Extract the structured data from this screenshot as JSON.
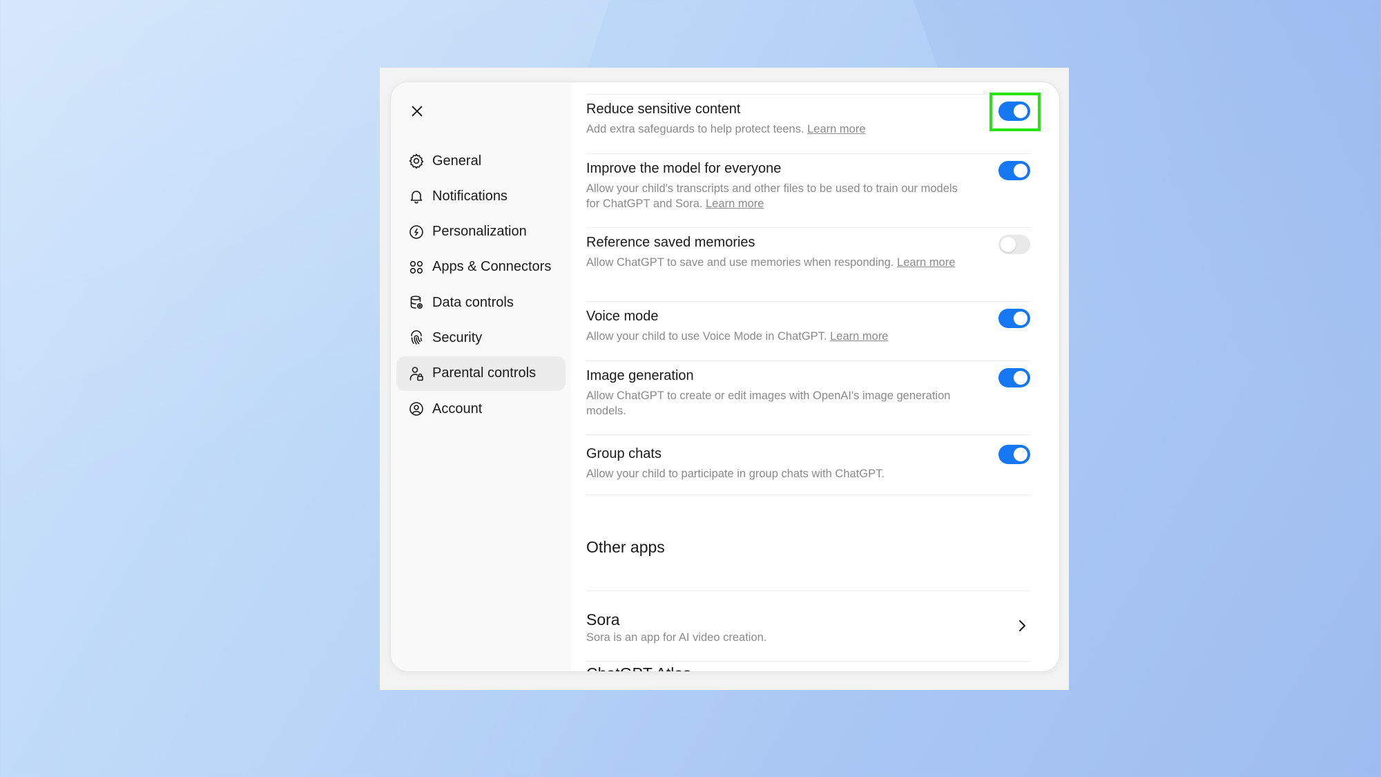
{
  "sidebar": {
    "close_icon": "close-icon",
    "items": [
      {
        "label": "General",
        "icon": "gear-icon"
      },
      {
        "label": "Notifications",
        "icon": "bell-icon"
      },
      {
        "label": "Personalization",
        "icon": "personalization-icon"
      },
      {
        "label": "Apps & Connectors",
        "icon": "apps-icon"
      },
      {
        "label": "Data controls",
        "icon": "database-icon"
      },
      {
        "label": "Security",
        "icon": "fingerprint-icon"
      },
      {
        "label": "Parental controls",
        "icon": "parental-icon"
      },
      {
        "label": "Account",
        "icon": "user-circle-icon"
      }
    ],
    "active_item": "Parental controls"
  },
  "settings": [
    {
      "title": "Reduce sensitive content",
      "desc": "Add extra safeguards to help protect teens.",
      "link": "Learn more",
      "enabled": true,
      "highlighted": true
    },
    {
      "title": "Improve the model for everyone",
      "desc": "Allow your child's transcripts and other files to be used to train our models for ChatGPT and Sora.",
      "link": "Learn more",
      "enabled": true
    },
    {
      "title": "Reference saved memories",
      "desc": "Allow ChatGPT to save and use memories when responding.",
      "link": "Learn more",
      "enabled": false
    },
    {
      "title": "Voice mode",
      "desc": "Allow your child to use Voice Mode in ChatGPT.",
      "link": "Learn more",
      "enabled": true
    },
    {
      "title": "Image generation",
      "desc": "Allow ChatGPT to create or edit images with OpenAI's image generation models.",
      "link": "",
      "enabled": true
    },
    {
      "title": "Group chats",
      "desc": "Allow your child to participate in group chats with ChatGPT.",
      "link": "",
      "enabled": true
    }
  ],
  "other_apps": {
    "heading": "Other apps",
    "items": [
      {
        "title": "Sora",
        "desc": "Sora is an app for AI video creation.",
        "icon": "chevron-right-icon"
      }
    ],
    "partial_next_title": "ChatGPT Atlas"
  },
  "colors": {
    "toggle_on": "#1677f2",
    "toggle_off": "#e8e8e8",
    "highlight": "#28e414"
  }
}
